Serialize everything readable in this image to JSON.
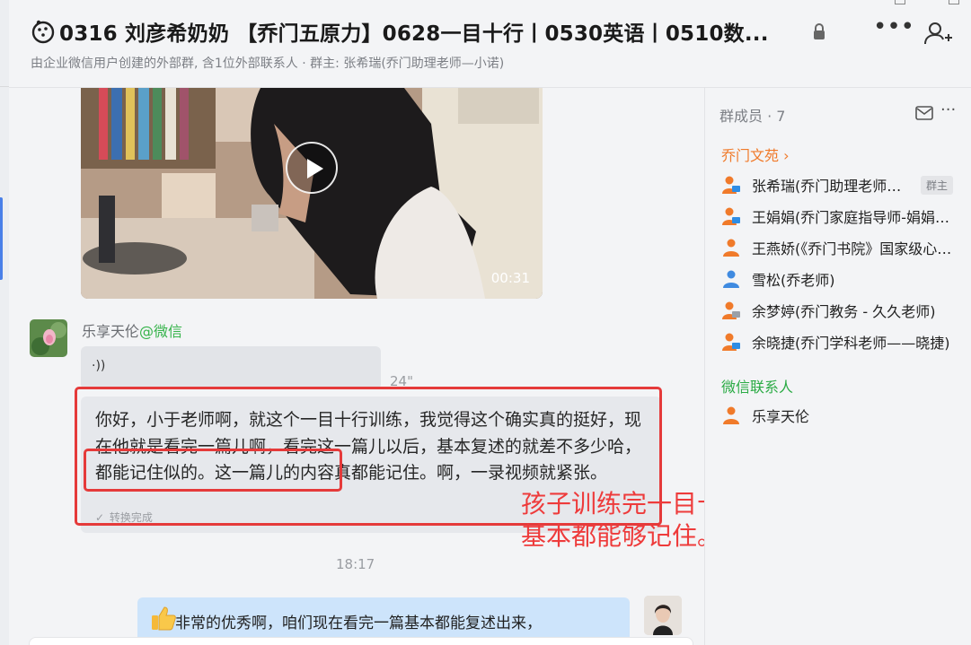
{
  "header": {
    "title": "0316  刘彦希奶奶 【乔门五原力】0628一目十行丨0530英语丨0510数...",
    "subtitle": "由企业微信用户创建的外部群, 含1位外部联系人 · 群主: 张希瑞(乔门助理老师—小诺)",
    "icons": [
      "group-chat-icon",
      "lock-icon",
      "more-icon",
      "add-member-icon"
    ]
  },
  "chat": {
    "video": {
      "duration": "00:31"
    },
    "message": {
      "sender": "乐享天伦",
      "sender_tag": "@微信",
      "voice_length": "24\"",
      "transcript": "你好，小于老师啊，就这个一目十行训练，我觉得这个确实真的挺好，现在他就是看完一篇儿啊，看完这一篇儿以后，基本复述的就差不多少哈，都能记住似的。这一篇儿的内容真都能记住。啊，一录视频就紧张。",
      "transcript_status": "转换完成"
    },
    "annotation": "孩子训练完一目十行的课程之后，基本都能够记住。",
    "time_divider": "18:17",
    "my_message": "非常的优秀啊，咱们现在看完一篇基本都能复述出来，"
  },
  "sidebar": {
    "title": "群成员 · 7",
    "org_section": "乔门文苑",
    "members": [
      {
        "name": "张希瑞(乔门助理老师—小诺)",
        "badge": "群主",
        "type": "staff"
      },
      {
        "name": "王娟娟(乔门家庭指导师-娟娟老师)",
        "type": "staff"
      },
      {
        "name": "王燕娇(《乔门书院》国家级心理咨询师)",
        "type": "orange"
      },
      {
        "name": "雪松(乔老师)",
        "type": "blue"
      },
      {
        "name": "余梦婷(乔门教务 - 久久老师)",
        "type": "staff-gray"
      },
      {
        "name": "余晓捷(乔门学科老师——晓捷)",
        "type": "staff"
      }
    ],
    "wechat_section": "微信联系人",
    "wechat_members": [
      {
        "name": "乐享天伦",
        "type": "orange"
      }
    ]
  },
  "colors": {
    "accent_red": "#e53a3a",
    "org_orange": "#f07a2a",
    "wechat_green": "#2bab45",
    "bubble_blue": "#cde4fb"
  }
}
